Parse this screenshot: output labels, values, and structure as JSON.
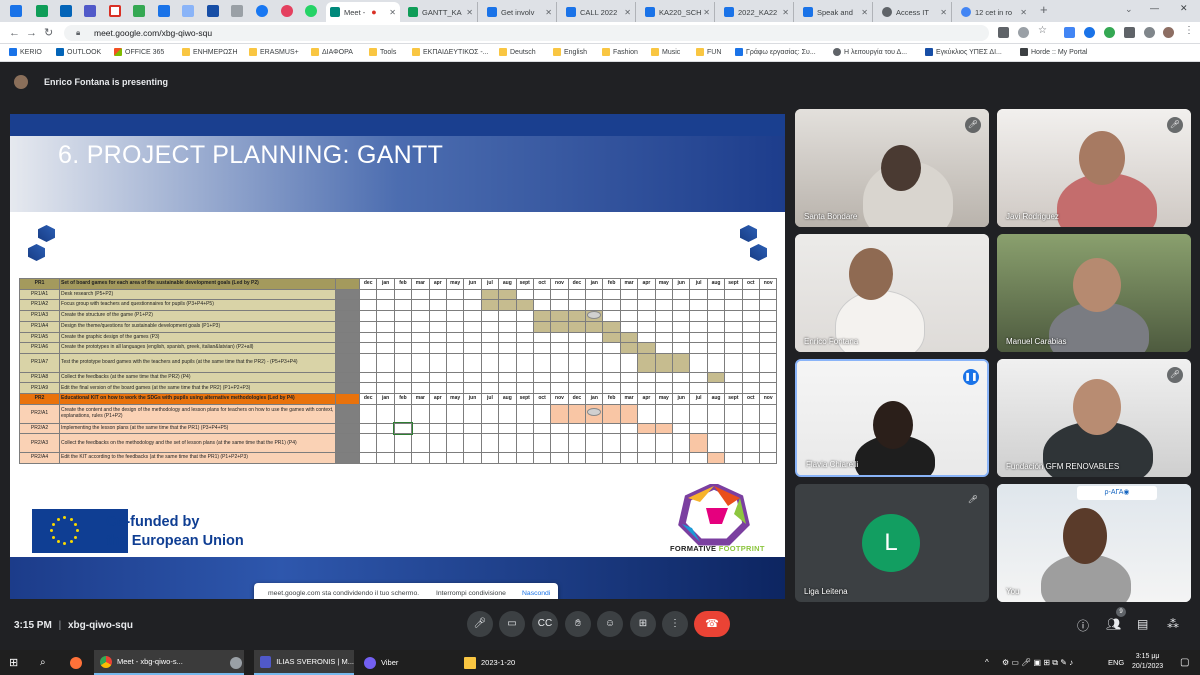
{
  "browser": {
    "tabs": [
      {
        "label": "Meet -",
        "color": "#00897b",
        "active": true
      },
      {
        "label": "GANTT_KA",
        "color": "#0f9d58"
      },
      {
        "label": "Get involv",
        "color": "#1a73e8"
      },
      {
        "label": "CALL 2022",
        "color": "#1a73e8"
      },
      {
        "label": "KA220_SCH",
        "color": "#1a73e8"
      },
      {
        "label": "2022_KA22",
        "color": "#1a73e8"
      },
      {
        "label": "Speak and",
        "color": "#1a73e8"
      },
      {
        "label": "Access IT",
        "color": "#5f6368"
      },
      {
        "label": "12 cet in ro",
        "color": "#4285f4"
      }
    ],
    "new_tab": "+",
    "url": "meet.google.com/xbg-qiwo-squ",
    "bookmarks": [
      "KERIO",
      "OUTLOOK",
      "OFFICE 365",
      "ΕΝΗΜΕΡΩΣΗ",
      "ERASMUS+",
      "ΔΙΑΦΟΡΑ",
      "Tools",
      "ΕΚΠΑΙΔΕΥΤΙΚΟΣ -...",
      "Deutsch",
      "English",
      "Fashion",
      "Music",
      "FUN",
      "Γράφω εργασίας: Συ...",
      "Η λειτουργία του Δ...",
      "Εγκύκλιος ΥΠΕΣ ΔΙ...",
      "Horde :: My Portal"
    ]
  },
  "meet": {
    "presenting": "Enrico Fontana is presenting",
    "meeting_code": "xbg-qiwo-squ",
    "time": "3:15 PM",
    "separator": "|",
    "people_count": "9",
    "share_notice": {
      "text": "meet.google.com sta condividendo il tuo schermo.",
      "stop": "Interrompi condivisione",
      "hide": "Nascondi"
    },
    "participants": [
      {
        "name": "Santa Bondare",
        "mic": "off"
      },
      {
        "name": "Javi Rodriguez",
        "mic": "off"
      },
      {
        "name": "Enrico Fontana",
        "mic": "on"
      },
      {
        "name": "Manuel Carabias",
        "mic": "on"
      },
      {
        "name": "Flavia Chiarelli",
        "mic": "speaking"
      },
      {
        "name": "Fundación GFM RENOVABLES",
        "mic": "off"
      },
      {
        "name": "Liga Leitena",
        "mic": "off",
        "initial": "L"
      },
      {
        "name": "You",
        "mic": "on"
      }
    ]
  },
  "slide": {
    "title": "6. PROJECT PLANNING: GANTT",
    "months": [
      "dec",
      "jan",
      "feb",
      "mar",
      "apr",
      "may",
      "jun",
      "jul",
      "aug",
      "sept",
      "oct",
      "nov",
      "dec",
      "jan",
      "feb",
      "mar",
      "apr",
      "may",
      "jun",
      "jul",
      "aug",
      "sept",
      "oct",
      "nov"
    ],
    "gantt_rows": [
      {
        "code": "PR1",
        "desc": "Set of board games for each area of the sustainable development goals (Led by P2)",
        "type": "h1"
      },
      {
        "code": "PR1/A1",
        "desc": "Desk research (P5+P2)",
        "fill": [
          7,
          8
        ]
      },
      {
        "code": "PR1/A2",
        "desc": "Focus group with teachers and questionnaires for pupils (P3+P4+P5)",
        "fill": [
          7,
          8,
          9
        ]
      },
      {
        "code": "PR1/A3",
        "desc": "Create the structure of the game (P1+P2)",
        "fill": [
          10,
          11,
          12,
          13
        ],
        "dot": 13
      },
      {
        "code": "PR1/A4",
        "desc": "Design the theme/questions for sustainable development goals (P1+P3)",
        "fill": [
          10,
          11,
          12,
          13,
          14
        ]
      },
      {
        "code": "PR1/A5",
        "desc": "Create the graphic design of the games (P3)",
        "fill": [
          14,
          15
        ]
      },
      {
        "code": "PR1/A6",
        "desc": "Create the prototypes in all languages (english, spanish, greek, italian&latvian) (P2+all)",
        "fill": [
          15,
          16
        ]
      },
      {
        "code": "PR1/A7",
        "desc": "Test the prototype board games with the teachers and pupils (at the same time that the PR2) - (P5+P3+P4)",
        "fill": [
          16,
          17,
          18
        ],
        "tall": true
      },
      {
        "code": "PR1/A8",
        "desc": "Collect the feedbacks (at the same time that the PR2) (P4)",
        "fill": [
          20
        ]
      },
      {
        "code": "PR1/A9",
        "desc": "Edit the final version of the board games (at the same time that the PR2) (P1+P2+P3)",
        "fill": []
      },
      {
        "code": "PR2",
        "desc": "Educational KIT on how to work the SDGs with pupils using alternative methodologies (Led by P4)",
        "type": "h2"
      },
      {
        "code": "PR2/A1",
        "desc": "Create the content and the design of the methodology and lesson plans for teachers on how to use the games with context, explanations, rules (P1+P2)",
        "fill": [
          11,
          12,
          13,
          14,
          15
        ],
        "dot": 13,
        "tall": true,
        "p2": true
      },
      {
        "code": "PR2/A2",
        "desc": "Implementing the lesson plans (at the same time that the PR1) (P3+P4+P5)",
        "fill": [
          16,
          17
        ],
        "p2": true
      },
      {
        "code": "PR2/A3",
        "desc": "Collect the feedbacks on the methodology and the set of lesson plans (at the same time that the PR1) (P4)",
        "fill": [
          19
        ],
        "tall": true,
        "p2": true
      },
      {
        "code": "PR2/A4",
        "desc": "Edit the KIT according to the feedbacks (at the same time that the PR1) (P1+P2+P3)",
        "fill": [
          20
        ],
        "p2": true
      }
    ],
    "cofunded_1": "Co-funded by",
    "cofunded_2": "the European Union",
    "logo_1": "FORMATIVE",
    "logo_2": "FOOTPRINT"
  },
  "taskbar": {
    "items": [
      "Meet - xbg-qiwo-s...",
      "ILIAS SVERONIS | M...",
      "Viber",
      "2023-1-20"
    ],
    "lang": "ENG",
    "time": "3:15 μμ",
    "date": "20/1/2023"
  },
  "colors": {
    "accent": "#1a73e8",
    "end_call": "#ea4335",
    "gantt_pr1": "#c6bc8f",
    "gantt_pr2": "#f9c6a5",
    "header_pr2": "#e9720b"
  }
}
